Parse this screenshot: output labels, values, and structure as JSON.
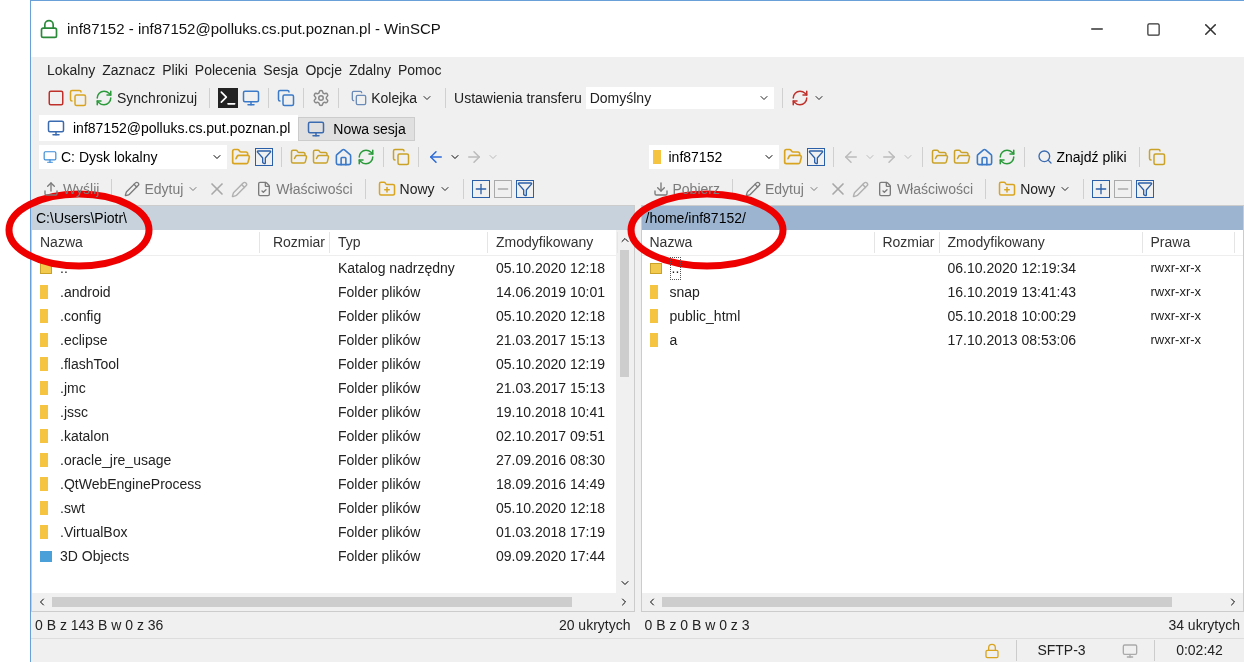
{
  "window": {
    "title": "inf87152 - inf87152@polluks.cs.put.poznan.pl - WinSCP"
  },
  "menu": [
    "Lokalny",
    "Zaznacz",
    "Pliki",
    "Polecenia",
    "Sesja",
    "Opcje",
    "Zdalny",
    "Pomoc"
  ],
  "toolbar": {
    "synchronize": "Synchronizuj",
    "queue": "Kolejka",
    "transfer_settings": "Ustawienia transferu",
    "transfer_preset": "Domyślny"
  },
  "tabs": [
    {
      "label": "inf87152@polluks.cs.put.poznan.pl",
      "selected": true
    },
    {
      "label": "Nowa sesja",
      "selected": false
    }
  ],
  "left_panel": {
    "location": "C: Dysk lokalny",
    "actions": [
      {
        "label": "Wyślij",
        "disabled": true
      },
      {
        "label": "Edytuj",
        "disabled": true
      },
      {
        "label": "Właściwości",
        "disabled": true
      },
      {
        "label": "Nowy",
        "disabled": false
      }
    ],
    "path": "C:\\Users\\Piotr\\",
    "columns": [
      "Nazwa",
      "Rozmiar",
      "Typ",
      "Zmodyfikowany"
    ],
    "rows": [
      {
        "kind": "parent",
        "name": "..",
        "type": "Katalog nadrzędny",
        "modified": "05.10.2020  12:18",
        "focused": false
      },
      {
        "kind": "folder",
        "name": ".android",
        "type": "Folder plików",
        "modified": "14.06.2019  10:01",
        "focused": false
      },
      {
        "kind": "folder",
        "name": ".config",
        "type": "Folder plików",
        "modified": "05.10.2020  12:18",
        "focused": false
      },
      {
        "kind": "folder",
        "name": ".eclipse",
        "type": "Folder plików",
        "modified": "21.03.2017  15:13",
        "focused": false
      },
      {
        "kind": "folder",
        "name": ".flashTool",
        "type": "Folder plików",
        "modified": "05.10.2020  12:19",
        "focused": false
      },
      {
        "kind": "folder",
        "name": ".jmc",
        "type": "Folder plików",
        "modified": "21.03.2017  15:13",
        "focused": false
      },
      {
        "kind": "folder",
        "name": ".jssc",
        "type": "Folder plików",
        "modified": "19.10.2018  10:41",
        "focused": false
      },
      {
        "kind": "folder",
        "name": ".katalon",
        "type": "Folder plików",
        "modified": "02.10.2017  09:51",
        "focused": false
      },
      {
        "kind": "folder",
        "name": ".oracle_jre_usage",
        "type": "Folder plików",
        "modified": "27.09.2016  08:30",
        "focused": false
      },
      {
        "kind": "folder",
        "name": ".QtWebEngineProcess",
        "type": "Folder plików",
        "modified": "18.09.2016  14:49",
        "focused": false
      },
      {
        "kind": "folder",
        "name": ".swt",
        "type": "Folder plików",
        "modified": "05.10.2020  12:18",
        "focused": false
      },
      {
        "kind": "folder",
        "name": ".VirtualBox",
        "type": "Folder plików",
        "modified": "01.03.2018  17:19",
        "focused": false
      },
      {
        "kind": "special",
        "name": "3D Objects",
        "type": "Folder plików",
        "modified": "09.09.2020  17:44",
        "focused": false
      }
    ],
    "summary": "0 B z 143 B w 0 z 36",
    "hidden": "20 ukrytych"
  },
  "right_panel": {
    "location": "inf87152",
    "find": "Znajdź pliki",
    "actions": [
      {
        "label": "Pobierz",
        "disabled": true
      },
      {
        "label": "Edytuj",
        "disabled": true
      },
      {
        "label": "Właściwości",
        "disabled": true
      },
      {
        "label": "Nowy",
        "disabled": false
      }
    ],
    "path": "/home/inf87152/",
    "columns": [
      "Nazwa",
      "Rozmiar",
      "Zmodyfikowany",
      "Prawa"
    ],
    "rows": [
      {
        "kind": "parent",
        "name": "..",
        "modified": "06.10.2020 12:19:34",
        "rights": "rwxr-xr-x",
        "focused": true
      },
      {
        "kind": "folder",
        "name": "snap",
        "modified": "16.10.2019 13:41:43",
        "rights": "rwxr-xr-x",
        "focused": false
      },
      {
        "kind": "folder",
        "name": "public_html",
        "modified": "05.10.2018 10:00:29",
        "rights": "rwxr-xr-x",
        "focused": false
      },
      {
        "kind": "folder",
        "name": "a",
        "modified": "17.10.2013 08:53:06",
        "rights": "rwxr-xr-x",
        "focused": false
      }
    ],
    "summary": "0 B z 0 B w 0 z 3",
    "hidden": "34 ukrytych"
  },
  "status_bar": {
    "protocol": "SFTP-3",
    "elapsed": "0:02:42"
  }
}
